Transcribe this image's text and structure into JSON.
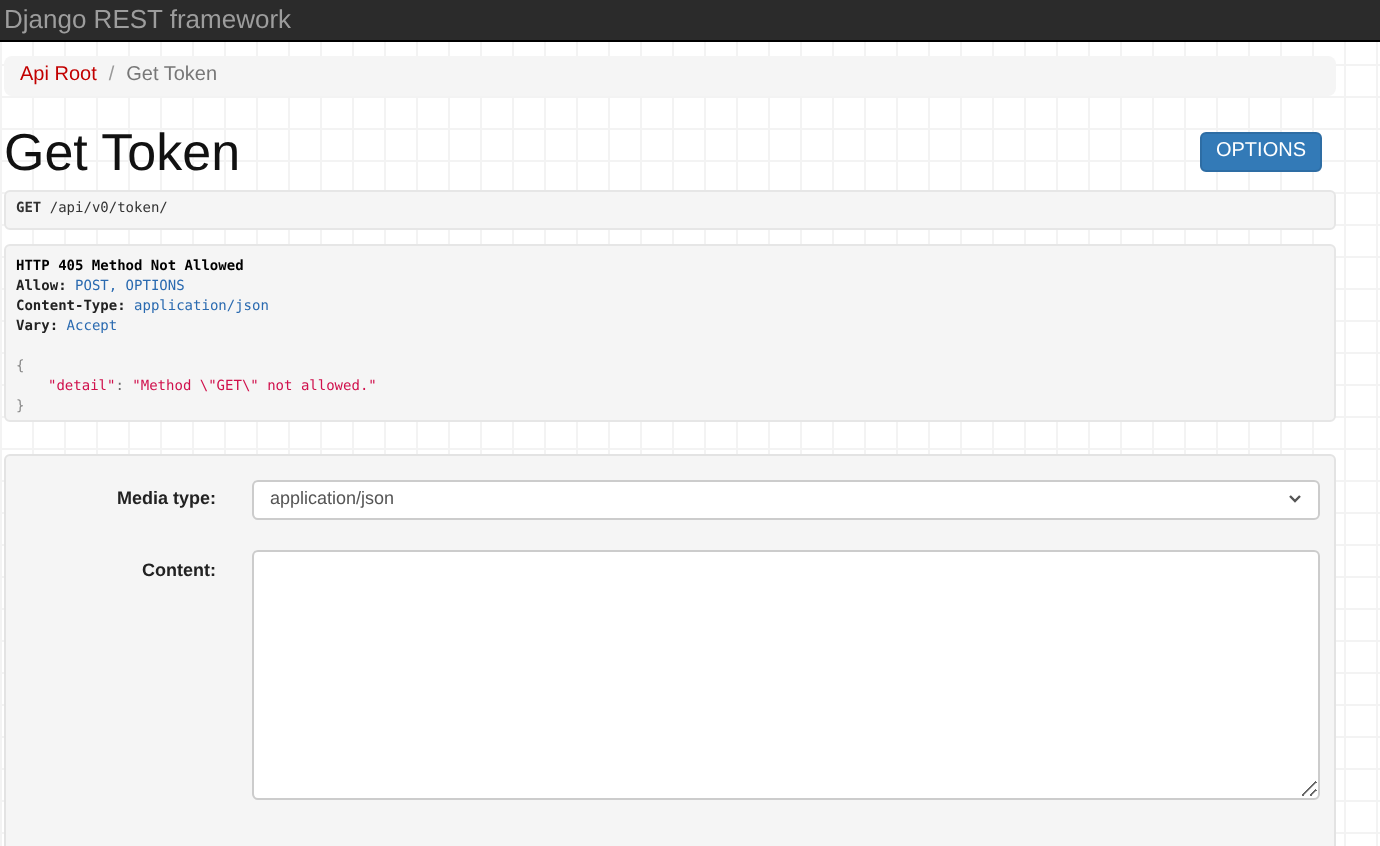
{
  "navbar": {
    "brand": "Django REST framework"
  },
  "breadcrumb_separator": "/",
  "breadcrumb": [
    {
      "label": "Api Root",
      "selected": false
    },
    {
      "label": "Get Token",
      "selected": true
    }
  ],
  "page_title": "Get Token",
  "options_button": "OPTIONS",
  "request": {
    "method": "GET",
    "path": "/api/v0/token/"
  },
  "response": {
    "status": "HTTP 405 Method Not Allowed",
    "headers": [
      {
        "name": "Allow:",
        "value": "POST, OPTIONS"
      },
      {
        "name": "Content-Type:",
        "value": "application/json"
      },
      {
        "name": "Vary:",
        "value": "Accept"
      }
    ],
    "body": [
      {
        "kind": "brace",
        "text": "{"
      },
      {
        "kind": "pair",
        "key": "\"detail\"",
        "separator": ":",
        "value": "\"Method \\\"GET\\\" not allowed.\""
      },
      {
        "kind": "brace",
        "text": "}"
      }
    ]
  },
  "form": {
    "media_type": {
      "label": "Media type:",
      "value": "application/json"
    },
    "content": {
      "label": "Content:"
    }
  }
}
